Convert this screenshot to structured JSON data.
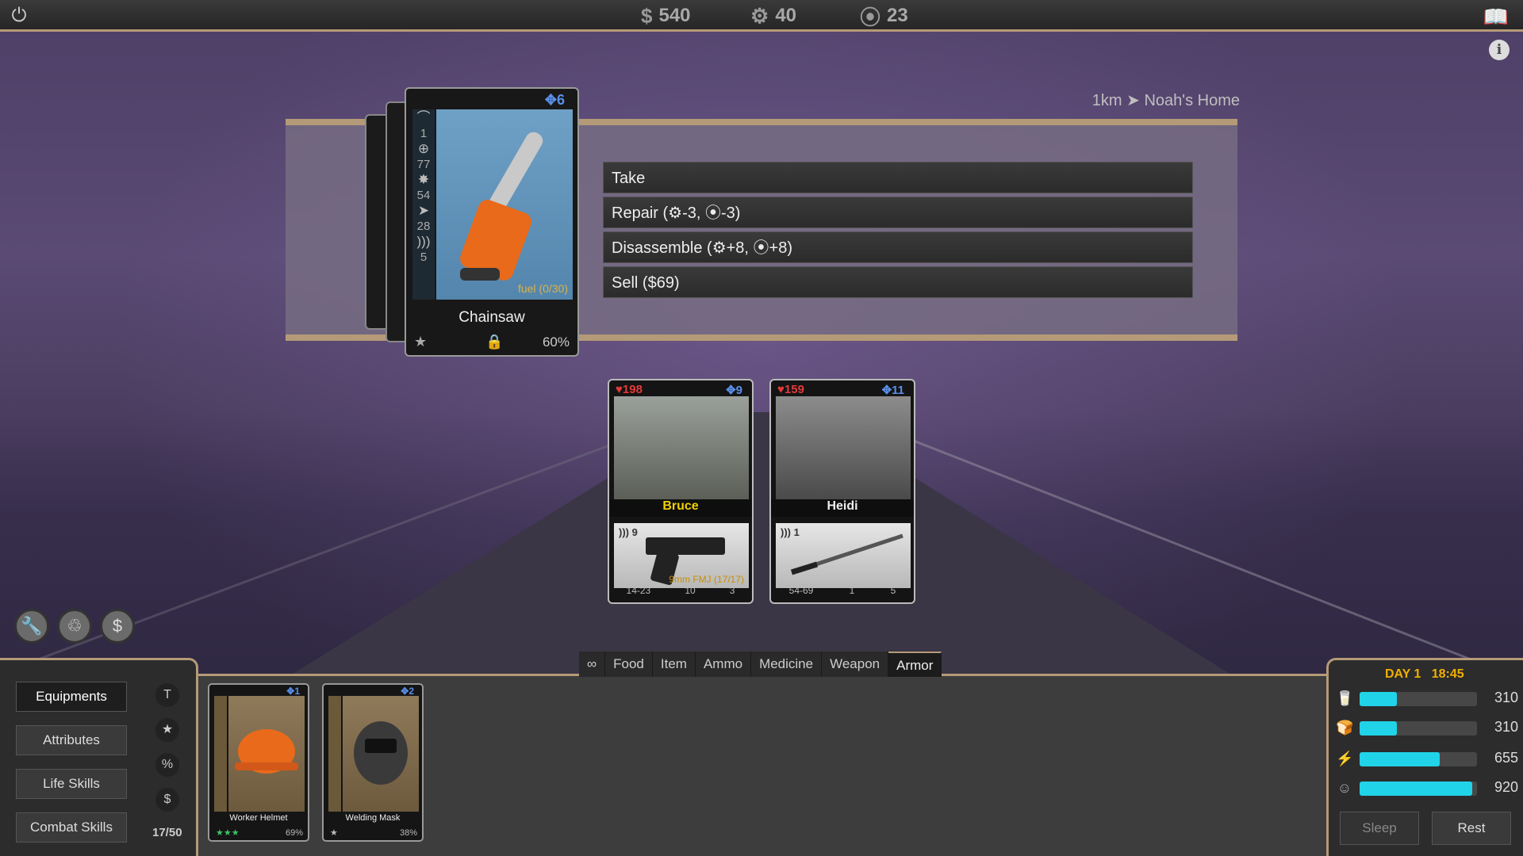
{
  "topbar": {
    "money": "540",
    "parts": "40",
    "gears": "23",
    "icons": [
      "power-icon",
      "dollar-icon",
      "parts-icon",
      "gear-icon",
      "book-icon",
      "info-icon"
    ]
  },
  "location": "1km ➤ Noah's Home",
  "selected_item": {
    "cost": "6",
    "stats": [
      "1",
      "77",
      "54",
      "28",
      "5"
    ],
    "fuel": "fuel (0/30)",
    "name": "Chainsaw",
    "condition": "60%"
  },
  "actions": [
    {
      "label": "Take"
    },
    {
      "label": "Repair (⚙-3, ⦿-3)"
    },
    {
      "label": "Disassemble (⚙+8, ⦿+8)"
    },
    {
      "label": "Sell ($69)"
    }
  ],
  "survivors": [
    {
      "name": "Bruce",
      "hp": "198",
      "ap": "9",
      "noise": "9",
      "ammo": "9mm FMJ (17/17)",
      "stats": [
        "14-23",
        "10",
        "3"
      ]
    },
    {
      "name": "Heidi",
      "hp": "159",
      "ap": "11",
      "noise": "1",
      "ammo": "",
      "stats": [
        "54-69",
        "1",
        "5"
      ]
    }
  ],
  "tabs": [
    "∞",
    "Food",
    "Item",
    "Ammo",
    "Medicine",
    "Weapon",
    "Armor"
  ],
  "active_tab": "Armor",
  "side_menu": [
    "Equipments",
    "Attributes",
    "Life Skills",
    "Combat Skills"
  ],
  "filters": [
    "T",
    "★",
    "%",
    "$"
  ],
  "inventory_count": "17/50",
  "armor_items": [
    {
      "name": "Worker Helmet",
      "cost": "1",
      "stars": "★★★",
      "condition": "69%"
    },
    {
      "name": "Welding Mask",
      "cost": "2",
      "stars": "★",
      "condition": "38%"
    }
  ],
  "status": {
    "day": "DAY 1",
    "time": "18:45",
    "bars": [
      {
        "icon": "water-icon",
        "value": "310",
        "fill": 0.32
      },
      {
        "icon": "food-icon",
        "value": "310",
        "fill": 0.32
      },
      {
        "icon": "energy-icon",
        "value": "655",
        "fill": 0.68
      },
      {
        "icon": "mood-icon",
        "value": "920",
        "fill": 0.96
      }
    ],
    "sleep": "Sleep",
    "rest": "Rest"
  },
  "colors": {
    "accent": "#b59a78",
    "bar": "#21d3e8",
    "hp": "#e23a3a",
    "ap": "#5a8fe8",
    "day": "#f0b000"
  }
}
